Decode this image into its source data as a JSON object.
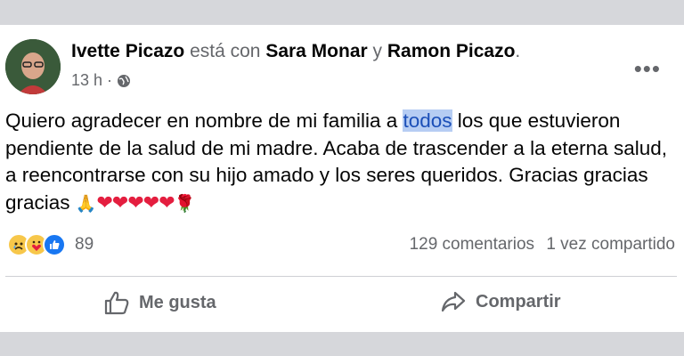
{
  "post": {
    "author": "Ivette Picazo",
    "with_word": "está con",
    "tag1": "Sara Monar",
    "and_word": "y",
    "tag2": "Ramon Picazo",
    "time": "13 h",
    "dot": "·",
    "text_before": "Quiero agradecer en nombre de mi familia a ",
    "text_highlight": "todos",
    "text_after": " los que estuvieron pendiente de la salud de mi madre. Acaba de trascender a la eterna salud, a reencontrarse con su hijo amado y los seres queridos. Gracias gracias gracias ",
    "emoji_praying": "🙏",
    "hearts": "❤❤❤❤❤",
    "emoji_rose": "🌹"
  },
  "reactions": {
    "icons": [
      "sad-reaction-icon",
      "care-reaction-icon",
      "like-reaction-icon"
    ],
    "count": "89"
  },
  "stats": {
    "comments": "129 comentarios",
    "shares": "1 vez compartido"
  },
  "actions": {
    "like_label": "Me gusta",
    "share_label": "Compartir"
  },
  "colors": {
    "brand_blue": "#1877f2",
    "heart_red": "#e41e3f",
    "highlight": "#b6cdf3"
  }
}
